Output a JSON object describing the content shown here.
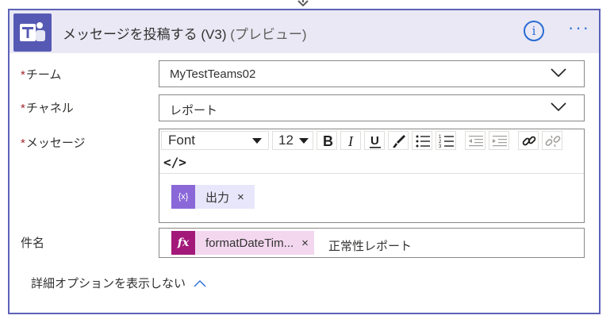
{
  "action": {
    "title_main": "メッセージを投稿する (V3)",
    "title_suffix": "(プレビュー)",
    "info_label": "i",
    "more_label": "···",
    "connector_icon": "teams-logo-icon"
  },
  "fields": {
    "team": {
      "required_mark": "*",
      "label": "チーム",
      "value": "MyTestTeams02"
    },
    "channel": {
      "required_mark": "*",
      "label": "チャネル",
      "value": "レポート"
    },
    "message": {
      "required_mark": "*",
      "label": "メッセージ",
      "toolbar": {
        "font": "Font",
        "size": "12",
        "code_view": "</>"
      },
      "token": {
        "icon_text": "{x}",
        "label": "出力",
        "close": "×"
      }
    },
    "subject": {
      "label": "件名",
      "token": {
        "icon_text": "fx",
        "label": "formatDateTim...",
        "close": "×"
      },
      "text": "正常性レポート"
    }
  },
  "advanced_toggle": "詳細オプションを表示しない",
  "colors": {
    "accent": "#5c62b8",
    "header_bg": "#e9e8f4",
    "link_blue": "#2b6cd4",
    "required_red": "#a4262c",
    "token_purple": "#8a68d8",
    "token_magenta": "#a3197a"
  }
}
